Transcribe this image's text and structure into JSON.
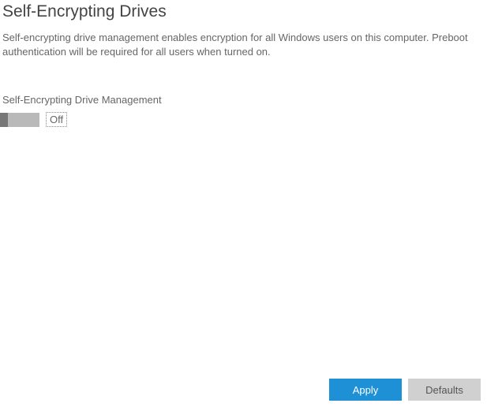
{
  "header": {
    "title": "Self-Encrypting Drives"
  },
  "description": "Self-encrypting drive management enables encryption for all Windows users on this computer. Preboot authentication will be required for all users when turned on.",
  "section": {
    "label": "Self-Encrypting Drive Management",
    "toggle_state": "Off"
  },
  "buttons": {
    "apply": "Apply",
    "defaults": "Defaults"
  }
}
